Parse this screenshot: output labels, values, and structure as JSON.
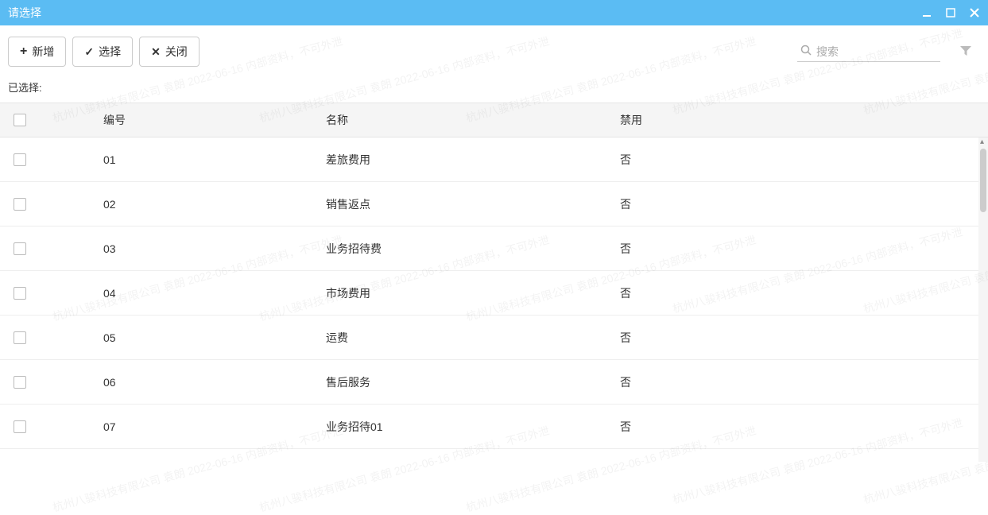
{
  "title": "请选择",
  "toolbar": {
    "add_label": "新增",
    "select_label": "选择",
    "close_label": "关闭"
  },
  "search": {
    "placeholder": "搜索"
  },
  "selected_label": "已选择:",
  "table": {
    "headers": {
      "code": "编号",
      "name": "名称",
      "disabled": "禁用"
    },
    "rows": [
      {
        "code": "01",
        "name": "差旅费用",
        "disabled": "否"
      },
      {
        "code": "02",
        "name": "销售返点",
        "disabled": "否"
      },
      {
        "code": "03",
        "name": "业务招待费",
        "disabled": "否"
      },
      {
        "code": "04",
        "name": "市场费用",
        "disabled": "否"
      },
      {
        "code": "05",
        "name": "运费",
        "disabled": "否"
      },
      {
        "code": "06",
        "name": "售后服务",
        "disabled": "否"
      },
      {
        "code": "07",
        "name": "业务招待01",
        "disabled": "否"
      }
    ]
  },
  "watermark_text": "杭州八骏科技有限公司 袁朗 2022-06-16 内部资料，不可外泄"
}
